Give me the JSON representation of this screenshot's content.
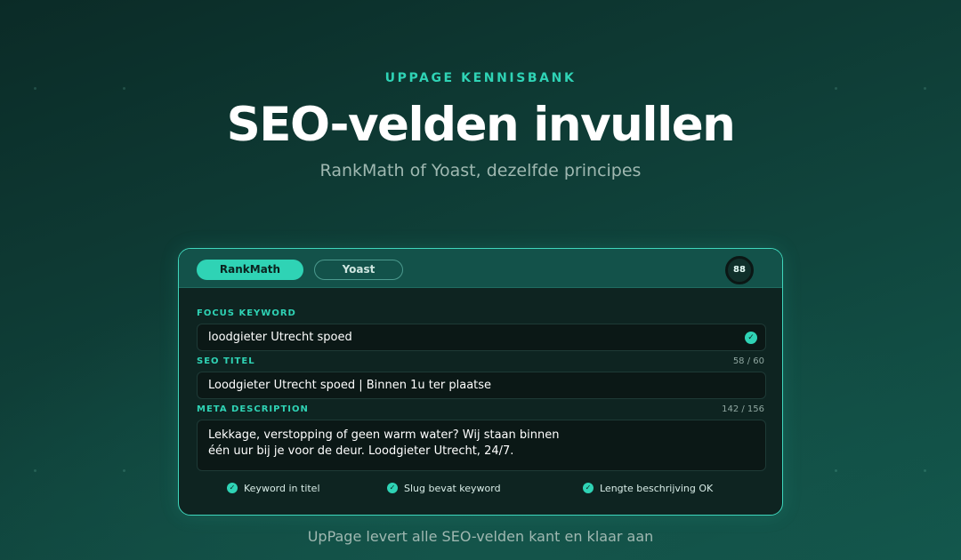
{
  "header": {
    "eyebrow": "UPPAGE KENNISBANK",
    "title": "SEO-velden invullen",
    "subtitle": "RankMath of Yoast, dezelfde principes"
  },
  "card": {
    "tabs": [
      {
        "label": "RankMath",
        "active": true
      },
      {
        "label": "Yoast",
        "active": false
      }
    ],
    "score": "88",
    "fields": {
      "focus_keyword": {
        "label": "FOCUS KEYWORD",
        "value": "loodgieter Utrecht spoed",
        "icon": "check-circle-icon"
      },
      "seo_title": {
        "label": "SEO TITEL",
        "counter": "58 / 60",
        "value": "Loodgieter Utrecht spoed | Binnen 1u ter plaatse"
      },
      "meta_description": {
        "label": "META DESCRIPTION",
        "counter": "142 / 156",
        "line1": "Lekkage, verstopping of geen warm water? Wij staan binnen",
        "line2": "één uur bij je voor de deur. Loodgieter Utrecht, 24/7."
      }
    },
    "checks": [
      {
        "label": "Keyword in titel",
        "icon": "check-circle-icon"
      },
      {
        "label": "Slug bevat keyword",
        "icon": "check-circle-icon"
      },
      {
        "label": "Lengte beschrijving OK",
        "icon": "check-circle-icon"
      }
    ]
  },
  "footer": {
    "tagline": "UpPage levert alle SEO-velden kant en klaar aan"
  },
  "colors": {
    "accent": "#2fd3b5",
    "background": "#0f3f38",
    "card_header": "#13524a",
    "field_bg": "#0b1816"
  }
}
